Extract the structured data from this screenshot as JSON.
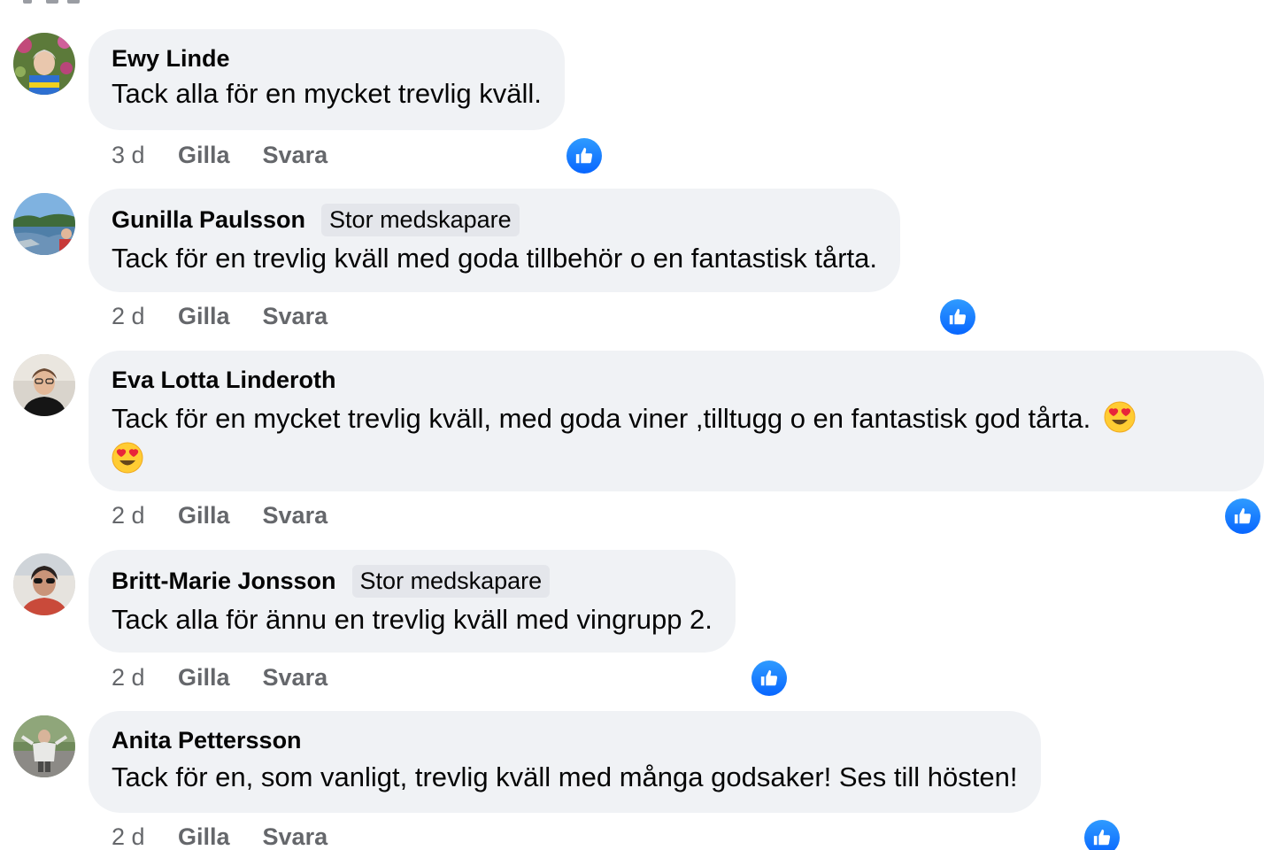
{
  "comments": [
    {
      "author": "Ewy Linde",
      "badge": "",
      "text": "Tack alla för en mycket trevlig kväll.",
      "time": "3 d",
      "like_label": "Gilla",
      "reply_label": "Svara",
      "reaction": "like-reaction-icon"
    },
    {
      "author": "Gunilla Paulsson",
      "badge": "Stor medskapare",
      "text": "Tack för en trevlig kväll med goda tillbehör o en fantastisk tårta.",
      "time": "2 d",
      "like_label": "Gilla",
      "reply_label": "Svara",
      "reaction": "like-reaction-icon"
    },
    {
      "author": "Eva Lotta Linderoth",
      "badge": "",
      "text": "Tack för en mycket trevlig kväll, med goda viner ,tilltugg o en fantastisk god tårta.",
      "emoji": "heart-eyes-emoji",
      "time": "2 d",
      "like_label": "Gilla",
      "reply_label": "Svara",
      "reaction": "like-reaction-icon"
    },
    {
      "author": "Britt-Marie Jonsson",
      "badge": "Stor medskapare",
      "text": "Tack alla för ännu en trevlig kväll med vingrupp 2.",
      "time": "2 d",
      "like_label": "Gilla",
      "reply_label": "Svara",
      "reaction": "like-reaction-icon"
    },
    {
      "author": "Anita Pettersson",
      "badge": "",
      "text": "Tack för en, som vanligt, trevlig kväll med många godsaker! Ses till hösten!",
      "time": "2 d",
      "like_label": "Gilla",
      "reply_label": "Svara",
      "reaction": "like-reaction-icon"
    }
  ],
  "colors": {
    "bubble": "#f0f2f5",
    "badge": "#e4e6eb",
    "meta_text": "#65676b",
    "like_blue": "#0866ff"
  }
}
